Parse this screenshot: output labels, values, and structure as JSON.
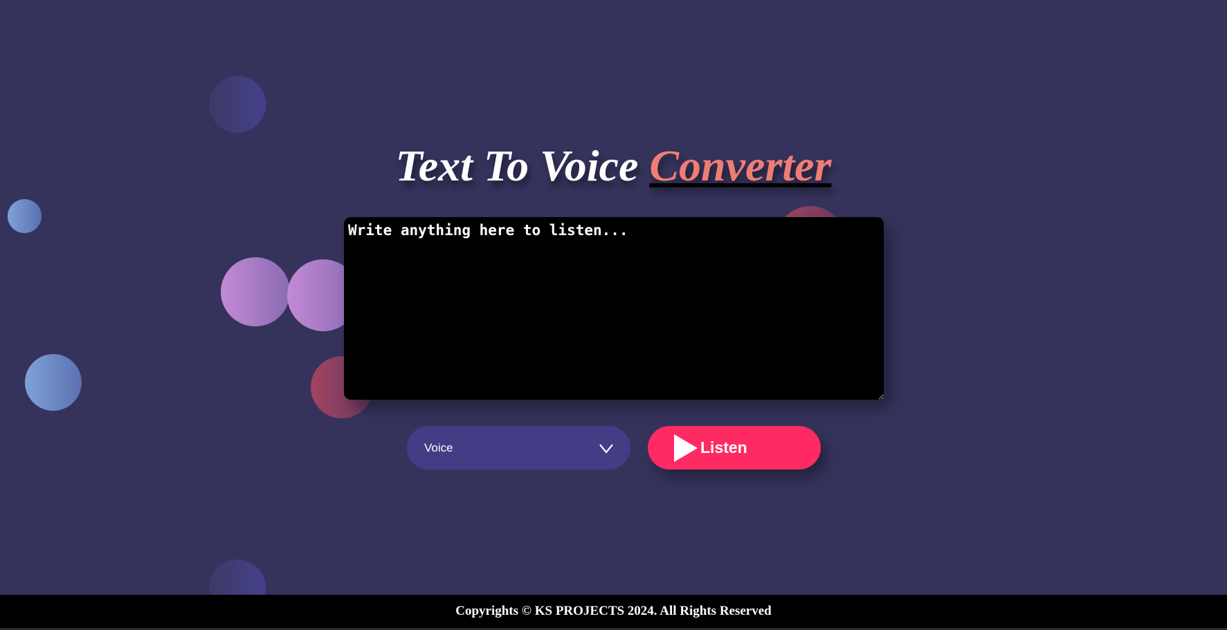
{
  "header": {
    "title_main": "Text To Voice ",
    "title_accent": "Converter"
  },
  "editor": {
    "placeholder": "Write anything here to listen...",
    "value": ""
  },
  "controls": {
    "voice_select_label": "Voice",
    "listen_label": "Listen"
  },
  "footer": {
    "text": "Copyrights © KS PROJECTS 2024. All Rights Reserved"
  },
  "colors": {
    "background": "#35335c",
    "accent": "#f07d74",
    "listen_button": "#ff2963",
    "select_background": "#423d85",
    "editor_background": "#000000",
    "footer_background": "#000000"
  },
  "icons": {
    "select_icon": "chevron-down-icon",
    "listen_icon": "play-icon"
  }
}
